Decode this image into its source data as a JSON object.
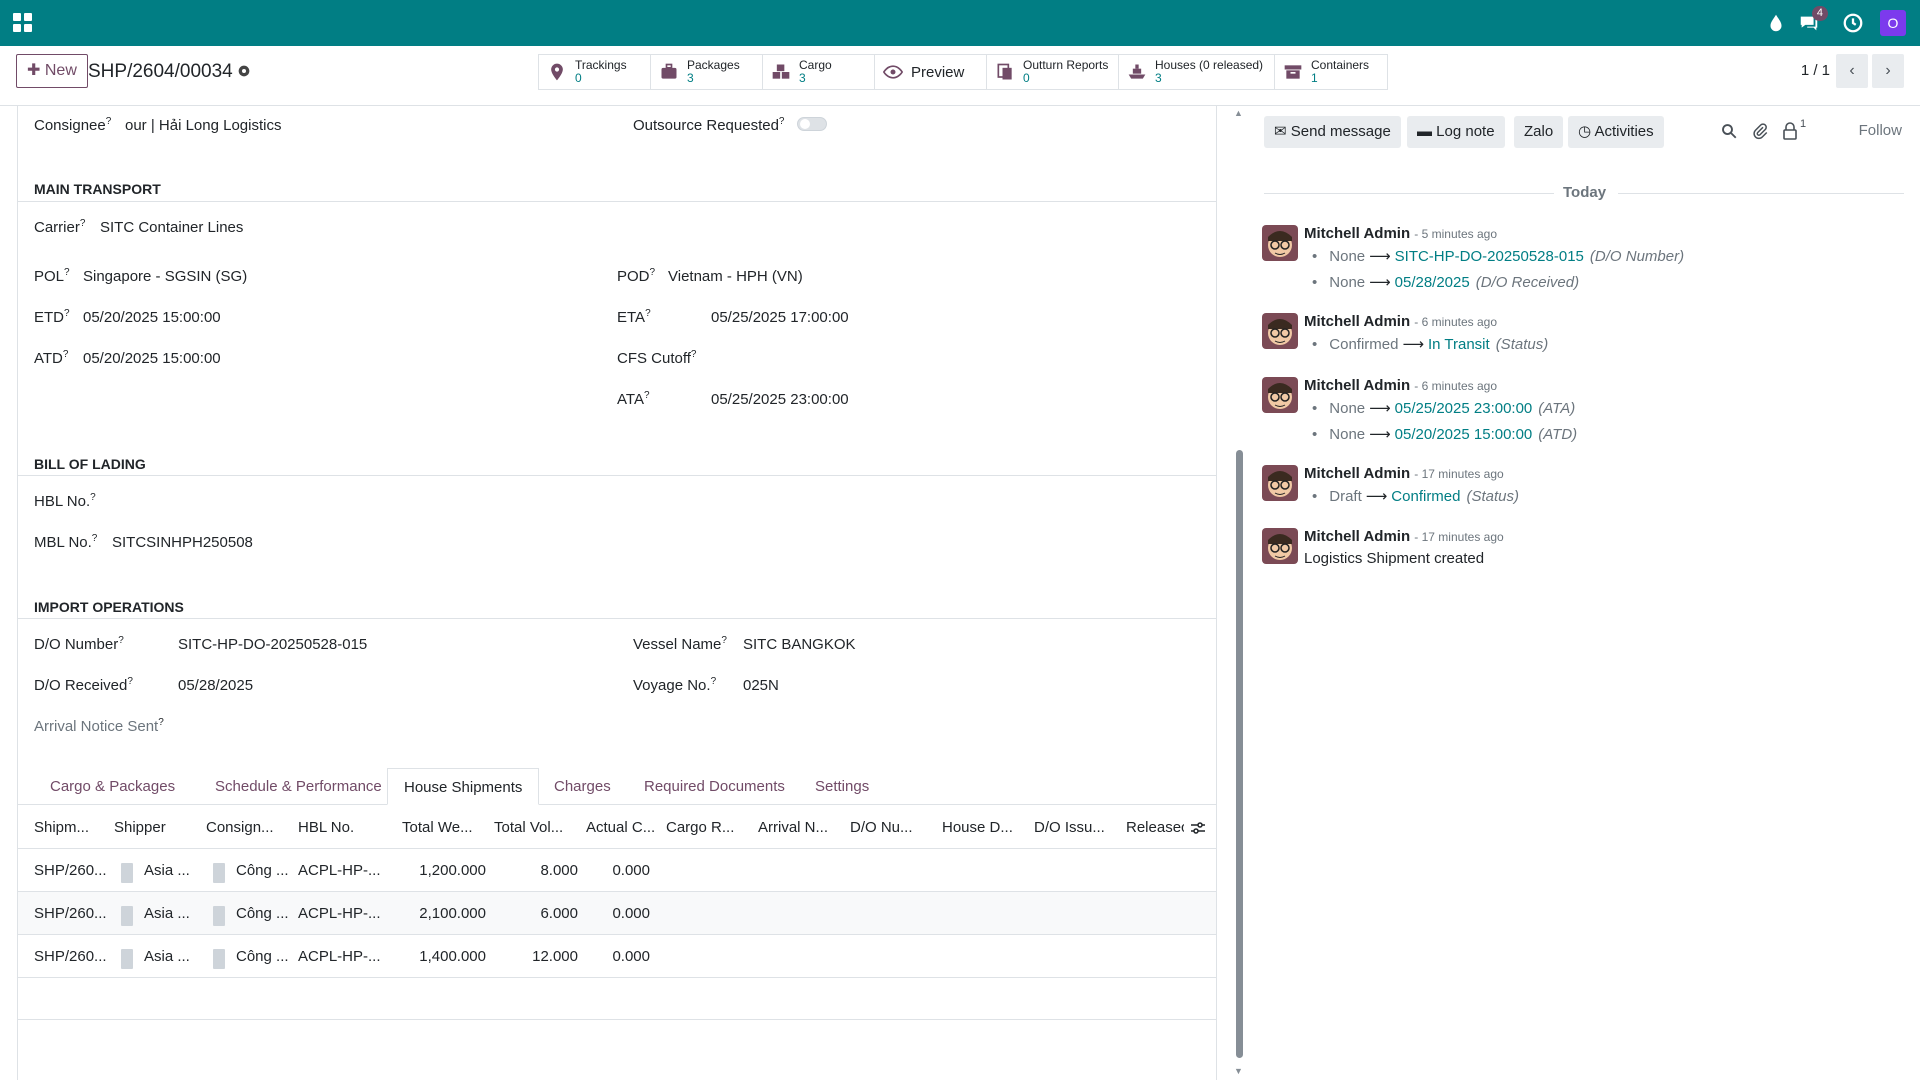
{
  "topbar": {
    "notification_badge": "4",
    "user_initial": "O",
    "accent": "#017e84"
  },
  "control": {
    "new_label": "New",
    "record_title": "SHP/2604/00034",
    "pager": "1 / 1",
    "smart_buttons": [
      {
        "label": "Trackings",
        "count": "0",
        "icon": "map-pin-icon"
      },
      {
        "label": "Packages",
        "count": "3",
        "icon": "suitcase-icon"
      },
      {
        "label": "Cargo",
        "count": "3",
        "icon": "cubes-icon"
      },
      {
        "label": "Preview",
        "count": "",
        "icon": "eye-icon"
      },
      {
        "label": "Outturn Reports",
        "count": "0",
        "icon": "document-icon"
      },
      {
        "label": "Houses (0 released)",
        "count": "3",
        "icon": "ship-icon"
      },
      {
        "label": "Containers",
        "count": "1",
        "icon": "archive-icon"
      }
    ]
  },
  "form": {
    "consignee_label": "Consignee",
    "consignee_value": "our | Hải Long Logistics",
    "outsource_label": "Outsource Requested",
    "main_transport": "MAIN TRANSPORT",
    "carrier_label": "Carrier",
    "carrier_value": "SITC Container Lines",
    "pol_label": "POL",
    "pol_value": "Singapore - SGSIN (SG)",
    "pod_label": "POD",
    "pod_value": "Vietnam - HPH (VN)",
    "etd_label": "ETD",
    "etd_value": "05/20/2025 15:00:00",
    "eta_label": "ETA",
    "eta_value": "05/25/2025 17:00:00",
    "atd_label": "ATD",
    "atd_value": "05/20/2025 15:00:00",
    "cfs_label": "CFS Cutoff",
    "ata_label": "ATA",
    "ata_value": "05/25/2025 23:00:00",
    "bill_of_lading": "BILL OF LADING",
    "hbl_label": "HBL No.",
    "mbl_label": "MBL No.",
    "mbl_value": "SITCSINHPH250508",
    "import_ops": "IMPORT OPERATIONS",
    "do_number_label": "D/O Number",
    "do_number_value": "SITC-HP-DO-20250528-015",
    "do_received_label": "D/O Received",
    "do_received_value": "05/28/2025",
    "vessel_label": "Vessel Name",
    "vessel_value": "SITC BANGKOK",
    "voyage_label": "Voyage No.",
    "voyage_value": "025N",
    "arrival_notice_label": "Arrival Notice Sent"
  },
  "tabs": [
    "Cargo & Packages",
    "Schedule & Performance",
    "House Shipments",
    "Charges",
    "Required Documents",
    "Settings"
  ],
  "table": {
    "headers": [
      "Shipm...",
      "Shipper",
      "Consign...",
      "HBL No.",
      "Total We...",
      "Total Vol...",
      "Actual C...",
      "Cargo R...",
      "Arrival N...",
      "D/O Nu...",
      "House D...",
      "D/O Issu...",
      "Releasec"
    ],
    "rows": [
      {
        "shipment": "SHP/260...",
        "shipper": "Asia ...",
        "consignee": "Công ...",
        "hbl": "ACPL-HP-...",
        "weight": "1,200.000",
        "volume": "8.000",
        "actual": "0.000"
      },
      {
        "shipment": "SHP/260...",
        "shipper": "Asia ...",
        "consignee": "Công ...",
        "hbl": "ACPL-HP-...",
        "weight": "2,100.000",
        "volume": "6.000",
        "actual": "0.000"
      },
      {
        "shipment": "SHP/260...",
        "shipper": "Asia ...",
        "consignee": "Công ...",
        "hbl": "ACPL-HP-...",
        "weight": "1,400.000",
        "volume": "12.000",
        "actual": "0.000"
      }
    ]
  },
  "chatter": {
    "send_message": "Send message",
    "log_note": "Log note",
    "zalo": "Zalo",
    "activities": "Activities",
    "follower_count": "1",
    "follow": "Follow",
    "today": "Today",
    "messages": [
      {
        "author": "Mitchell Admin",
        "ago": "- 5 minutes ago",
        "changes": [
          {
            "old": "None",
            "new": "SITC-HP-DO-20250528-015",
            "field": "(D/O Number)"
          },
          {
            "old": "None",
            "new": "05/28/2025",
            "field": "(D/O Received)"
          }
        ]
      },
      {
        "author": "Mitchell Admin",
        "ago": "- 6 minutes ago",
        "changes": [
          {
            "old": "Confirmed",
            "new": "In Transit",
            "field": "(Status)"
          }
        ]
      },
      {
        "author": "Mitchell Admin",
        "ago": "- 6 minutes ago",
        "changes": [
          {
            "old": "None",
            "new": "05/25/2025 23:00:00",
            "field": "(ATA)"
          },
          {
            "old": "None",
            "new": "05/20/2025 15:00:00",
            "field": "(ATD)"
          }
        ]
      },
      {
        "author": "Mitchell Admin",
        "ago": "- 17 minutes ago",
        "changes": [
          {
            "old": "Draft",
            "new": "Confirmed",
            "field": "(Status)"
          }
        ]
      },
      {
        "author": "Mitchell Admin",
        "ago": "- 17 minutes ago",
        "body": "Logistics Shipment created"
      }
    ]
  }
}
